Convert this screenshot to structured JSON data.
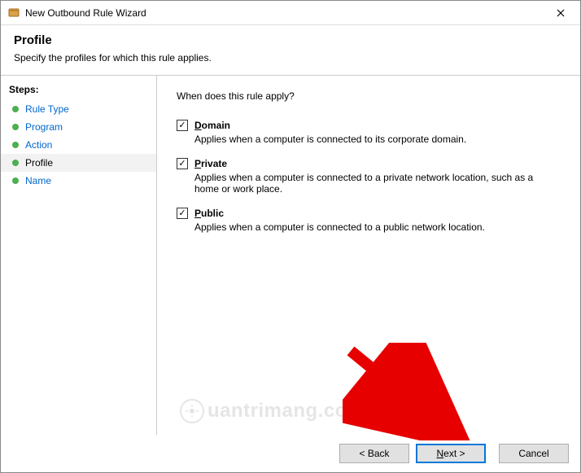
{
  "window": {
    "title": "New Outbound Rule Wizard"
  },
  "header": {
    "title": "Profile",
    "subtitle": "Specify the profiles for which this rule applies."
  },
  "sidebar": {
    "heading": "Steps:",
    "items": [
      {
        "label": "Rule Type",
        "state": "done"
      },
      {
        "label": "Program",
        "state": "done"
      },
      {
        "label": "Action",
        "state": "done"
      },
      {
        "label": "Profile",
        "state": "active"
      },
      {
        "label": "Name",
        "state": "pending"
      }
    ]
  },
  "main": {
    "question": "When does this rule apply?",
    "options": [
      {
        "checked": true,
        "mnemonic": "D",
        "rest": "omain",
        "desc": "Applies when a computer is connected to its corporate domain."
      },
      {
        "checked": true,
        "mnemonic": "P",
        "rest": "rivate",
        "desc": "Applies when a computer is connected to a private network location, such as a home or work place."
      },
      {
        "checked": true,
        "mnemonic": "P",
        "rest": "ublic",
        "desc": "Applies when a computer is connected to a public network location."
      }
    ]
  },
  "footer": {
    "back": "< Back",
    "next": "Next >",
    "cancel": "Cancel"
  },
  "watermark": {
    "text": "uantrimang.com"
  }
}
